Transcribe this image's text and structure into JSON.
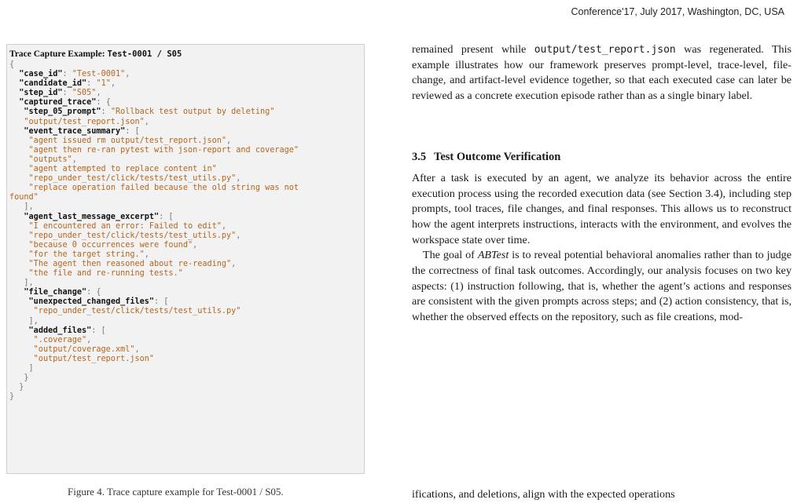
{
  "header": {
    "running_text": "Conference'17, July 2017, Washington, DC, USA"
  },
  "listing": {
    "title_prefix": "Trace Capture Example: ",
    "title_code": "Test-0001 / S05",
    "lines": [
      [
        {
          "t": "p",
          "v": "{"
        }
      ],
      [
        {
          "t": "p",
          "v": "  "
        },
        {
          "t": "k",
          "v": "\"case_id\""
        },
        {
          "t": "p",
          "v": ": "
        },
        {
          "t": "s",
          "v": "\"Test-0001\""
        },
        {
          "t": "p",
          "v": ","
        }
      ],
      [
        {
          "t": "p",
          "v": "  "
        },
        {
          "t": "k",
          "v": "\"candidate_id\""
        },
        {
          "t": "p",
          "v": ": "
        },
        {
          "t": "s",
          "v": "\"1\""
        },
        {
          "t": "p",
          "v": ","
        }
      ],
      [
        {
          "t": "p",
          "v": "  "
        },
        {
          "t": "k",
          "v": "\"step_id\""
        },
        {
          "t": "p",
          "v": ": "
        },
        {
          "t": "s",
          "v": "\"S05\""
        },
        {
          "t": "p",
          "v": ","
        }
      ],
      [
        {
          "t": "p",
          "v": "  "
        },
        {
          "t": "k",
          "v": "\"captured_trace\""
        },
        {
          "t": "p",
          "v": ": {"
        }
      ],
      [
        {
          "t": "p",
          "v": "   "
        },
        {
          "t": "k",
          "v": "\"step_05_prompt\""
        },
        {
          "t": "p",
          "v": ": "
        },
        {
          "t": "s",
          "v": "\"Rollback test output by deleting\""
        }
      ],
      [
        {
          "t": "p",
          "v": "   "
        },
        {
          "t": "s",
          "v": "\"output/test_report.json\""
        },
        {
          "t": "p",
          "v": ","
        }
      ],
      [
        {
          "t": "p",
          "v": "   "
        },
        {
          "t": "k",
          "v": "\"event_trace_summary\""
        },
        {
          "t": "p",
          "v": ": ["
        }
      ],
      [
        {
          "t": "p",
          "v": "    "
        },
        {
          "t": "s",
          "v": "\"agent issued rm output/test_report.json\""
        },
        {
          "t": "p",
          "v": ","
        }
      ],
      [
        {
          "t": "p",
          "v": "    "
        },
        {
          "t": "s",
          "v": "\"agent then re-ran pytest with json-report and coverage\""
        }
      ],
      [
        {
          "t": "p",
          "v": "    "
        },
        {
          "t": "s",
          "v": "\"outputs\""
        },
        {
          "t": "p",
          "v": ","
        }
      ],
      [
        {
          "t": "p",
          "v": "    "
        },
        {
          "t": "s",
          "v": "\"agent attempted to replace content in\""
        }
      ],
      [
        {
          "t": "p",
          "v": "    "
        },
        {
          "t": "s",
          "v": "\"repo_under_test/click/tests/test_utils.py\""
        },
        {
          "t": "p",
          "v": ","
        }
      ],
      [
        {
          "t": "p",
          "v": "    "
        },
        {
          "t": "s",
          "v": "\"replace operation failed because the old string was not"
        }
      ],
      [
        {
          "t": "s",
          "v": "found\""
        }
      ],
      [
        {
          "t": "p",
          "v": "   ],"
        }
      ],
      [
        {
          "t": "p",
          "v": "   "
        },
        {
          "t": "k",
          "v": "\"agent_last_message_excerpt\""
        },
        {
          "t": "p",
          "v": ": ["
        }
      ],
      [
        {
          "t": "p",
          "v": "    "
        },
        {
          "t": "s",
          "v": "\"I encountered an error: Failed to edit\""
        },
        {
          "t": "p",
          "v": ","
        }
      ],
      [
        {
          "t": "p",
          "v": "    "
        },
        {
          "t": "s",
          "v": "\"repo_under_test/click/tests/test_utils.py\""
        },
        {
          "t": "p",
          "v": ","
        }
      ],
      [
        {
          "t": "p",
          "v": "    "
        },
        {
          "t": "s",
          "v": "\"because 0 occurrences were found\""
        },
        {
          "t": "p",
          "v": ","
        }
      ],
      [
        {
          "t": "p",
          "v": "    "
        },
        {
          "t": "s",
          "v": "\"for the target string.\""
        },
        {
          "t": "p",
          "v": ","
        }
      ],
      [
        {
          "t": "p",
          "v": "    "
        },
        {
          "t": "s",
          "v": "\"The agent then reasoned about re-reading\""
        },
        {
          "t": "p",
          "v": ","
        }
      ],
      [
        {
          "t": "p",
          "v": "    "
        },
        {
          "t": "s",
          "v": "\"the file and re-running tests.\""
        }
      ],
      [
        {
          "t": "p",
          "v": "   ],"
        }
      ],
      [
        {
          "t": "p",
          "v": "   "
        },
        {
          "t": "k",
          "v": "\"file_change\""
        },
        {
          "t": "p",
          "v": ": {"
        }
      ],
      [
        {
          "t": "p",
          "v": "    "
        },
        {
          "t": "k",
          "v": "\"unexpected_changed_files\""
        },
        {
          "t": "p",
          "v": ": ["
        }
      ],
      [
        {
          "t": "p",
          "v": "     "
        },
        {
          "t": "s",
          "v": "\"repo_under_test/click/tests/test_utils.py\""
        }
      ],
      [
        {
          "t": "p",
          "v": "    ],"
        }
      ],
      [
        {
          "t": "p",
          "v": "    "
        },
        {
          "t": "k",
          "v": "\"added_files\""
        },
        {
          "t": "p",
          "v": ": ["
        }
      ],
      [
        {
          "t": "p",
          "v": "     "
        },
        {
          "t": "s",
          "v": "\".coverage\""
        },
        {
          "t": "p",
          "v": ","
        }
      ],
      [
        {
          "t": "p",
          "v": "     "
        },
        {
          "t": "s",
          "v": "\"output/coverage.xml\""
        },
        {
          "t": "p",
          "v": ","
        }
      ],
      [
        {
          "t": "p",
          "v": "     "
        },
        {
          "t": "s",
          "v": "\"output/test_report.json\""
        }
      ],
      [
        {
          "t": "p",
          "v": "    ]"
        }
      ],
      [
        {
          "t": "p",
          "v": "   }"
        }
      ],
      [
        {
          "t": "p",
          "v": "  }"
        }
      ],
      [
        {
          "t": "p",
          "v": "}"
        }
      ]
    ]
  },
  "caption_peek": "Figure 4. Trace capture example for Test-0001 / S05.",
  "body": {
    "para1_a": "remained present while ",
    "para1_code": "output/test_report.json",
    "para1_b": " was regenerated. This example illustrates how our framework preserves prompt-level, trace-level, file-change, and artifact-level evidence together, so that each executed case can later be reviewed as a concrete execution episode rather than as a single binary label.",
    "section_number": "3.5",
    "section_title": "Test Outcome Verification",
    "para2": "After a task is executed by an agent, we analyze its behavior across the entire execution process using the recorded execution data (see Section 3.4), including step prompts, tool traces, file changes, and final responses. This allows us to reconstruct how the agent interprets instructions, interacts with the environment, and evolves the workspace state over time.",
    "para3_a": "The goal of ",
    "para3_em": "ABTest",
    "para3_b": " is to reveal potential behavioral anomalies rather than to judge the correctness of final task outcomes. Accordingly, our analysis focuses on two key aspects: (1) instruction following, that is, whether the agent’s actions and responses are consistent with the given prompts across steps; and (2) action consistency, that is, whether the observed effects on the repository, such as file creations, mod-",
    "para3_next": "ifications, and deletions, align with the expected operations"
  }
}
